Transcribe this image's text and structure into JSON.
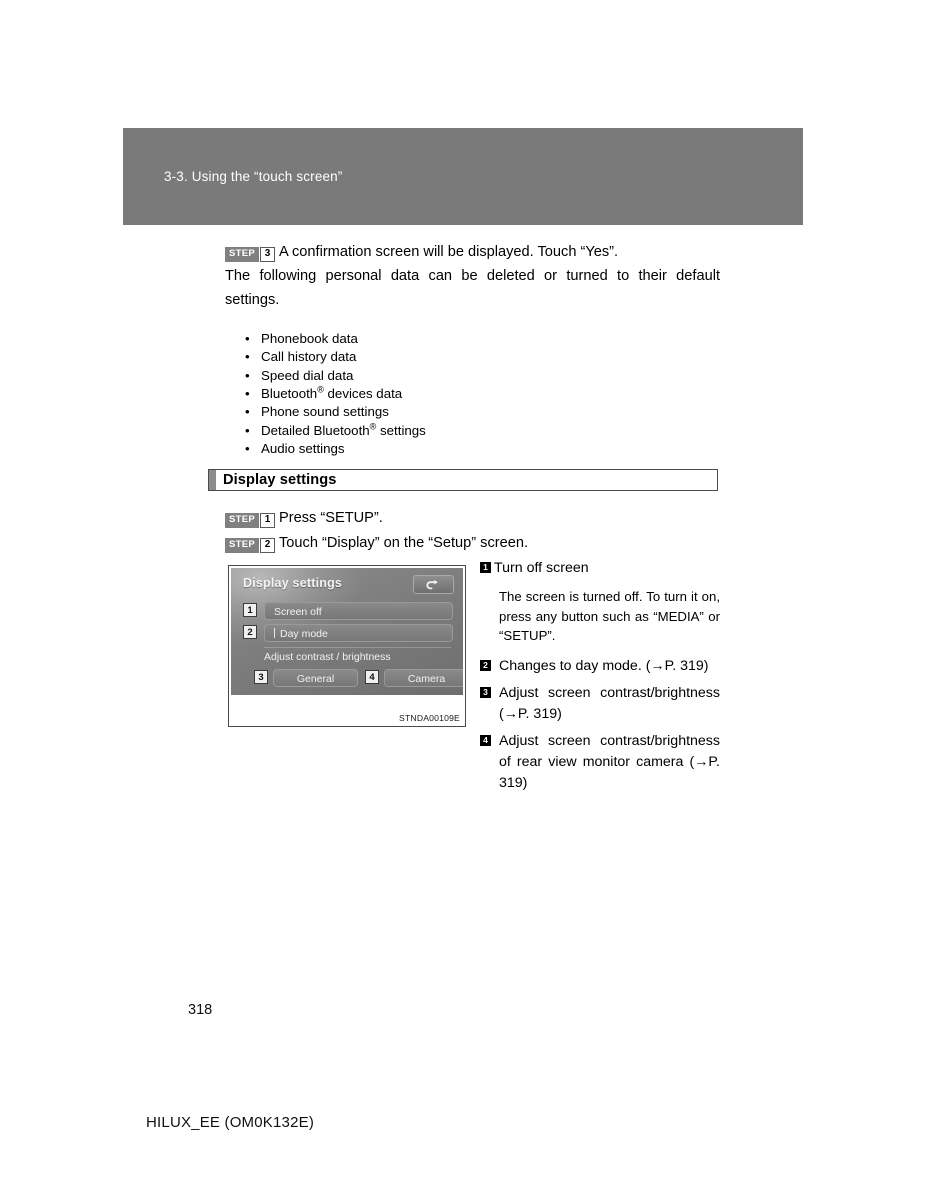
{
  "header": {
    "chapter_title": "3-3. Using the “touch screen”",
    "band_color": "#7a7a7a"
  },
  "intro": {
    "step3": {
      "word": "STEP",
      "number": "3"
    },
    "step3_text": "A confirmation screen will be displayed. Touch “Yes”.",
    "paragraph": "The following personal data can be deleted or turned to their default settings.",
    "bullets": [
      {
        "text_before": "Phonebook data",
        "sup": "",
        "text_after": ""
      },
      {
        "text_before": "Call history data",
        "sup": "",
        "text_after": ""
      },
      {
        "text_before": "Speed dial data",
        "sup": "",
        "text_after": ""
      },
      {
        "text_before": "Bluetooth",
        "sup": "®",
        "text_after": " devices data"
      },
      {
        "text_before": "Phone sound settings",
        "sup": "",
        "text_after": ""
      },
      {
        "text_before": "Detailed Bluetooth",
        "sup": "®",
        "text_after": " settings"
      },
      {
        "text_before": "Audio settings",
        "sup": "",
        "text_after": ""
      }
    ],
    "bullet_dot": "•"
  },
  "section": {
    "title": "Display settings",
    "steps": [
      {
        "word": "STEP",
        "number": "1",
        "text": "Press “SETUP”."
      },
      {
        "word": "STEP",
        "number": "2",
        "text": "Touch “Display” on the “Setup” screen."
      }
    ]
  },
  "figure": {
    "screen_title": "Display settings",
    "back_icon": "back-arrow-icon",
    "rows": [
      {
        "num": "1",
        "label": "Screen off",
        "has_caret": false
      },
      {
        "num": "2",
        "label": "Day mode",
        "has_caret": true
      }
    ],
    "adjust_label": "Adjust contrast / brightness",
    "buttons": [
      {
        "num": "3",
        "label": "General"
      },
      {
        "num": "4",
        "label": "Camera"
      }
    ],
    "caption": "STNDA00109E"
  },
  "legend": [
    {
      "num": "1",
      "head": "Turn off screen",
      "desc": "The screen is turned off. To turn it on, press any button such as “MEDIA” or “SETUP”."
    },
    {
      "num": "2",
      "head": "Changes to day mode. (→P. 319)",
      "desc": ""
    },
    {
      "num": "3",
      "head": "Adjust screen contrast/brightness (→P. 319)",
      "desc": ""
    },
    {
      "num": "4",
      "head": "Adjust screen contrast/brightness of rear view monitor camera (→P. 319)",
      "desc": ""
    }
  ],
  "footer": {
    "page_number": "318",
    "doc_code": "HILUX_EE (OM0K132E)"
  }
}
